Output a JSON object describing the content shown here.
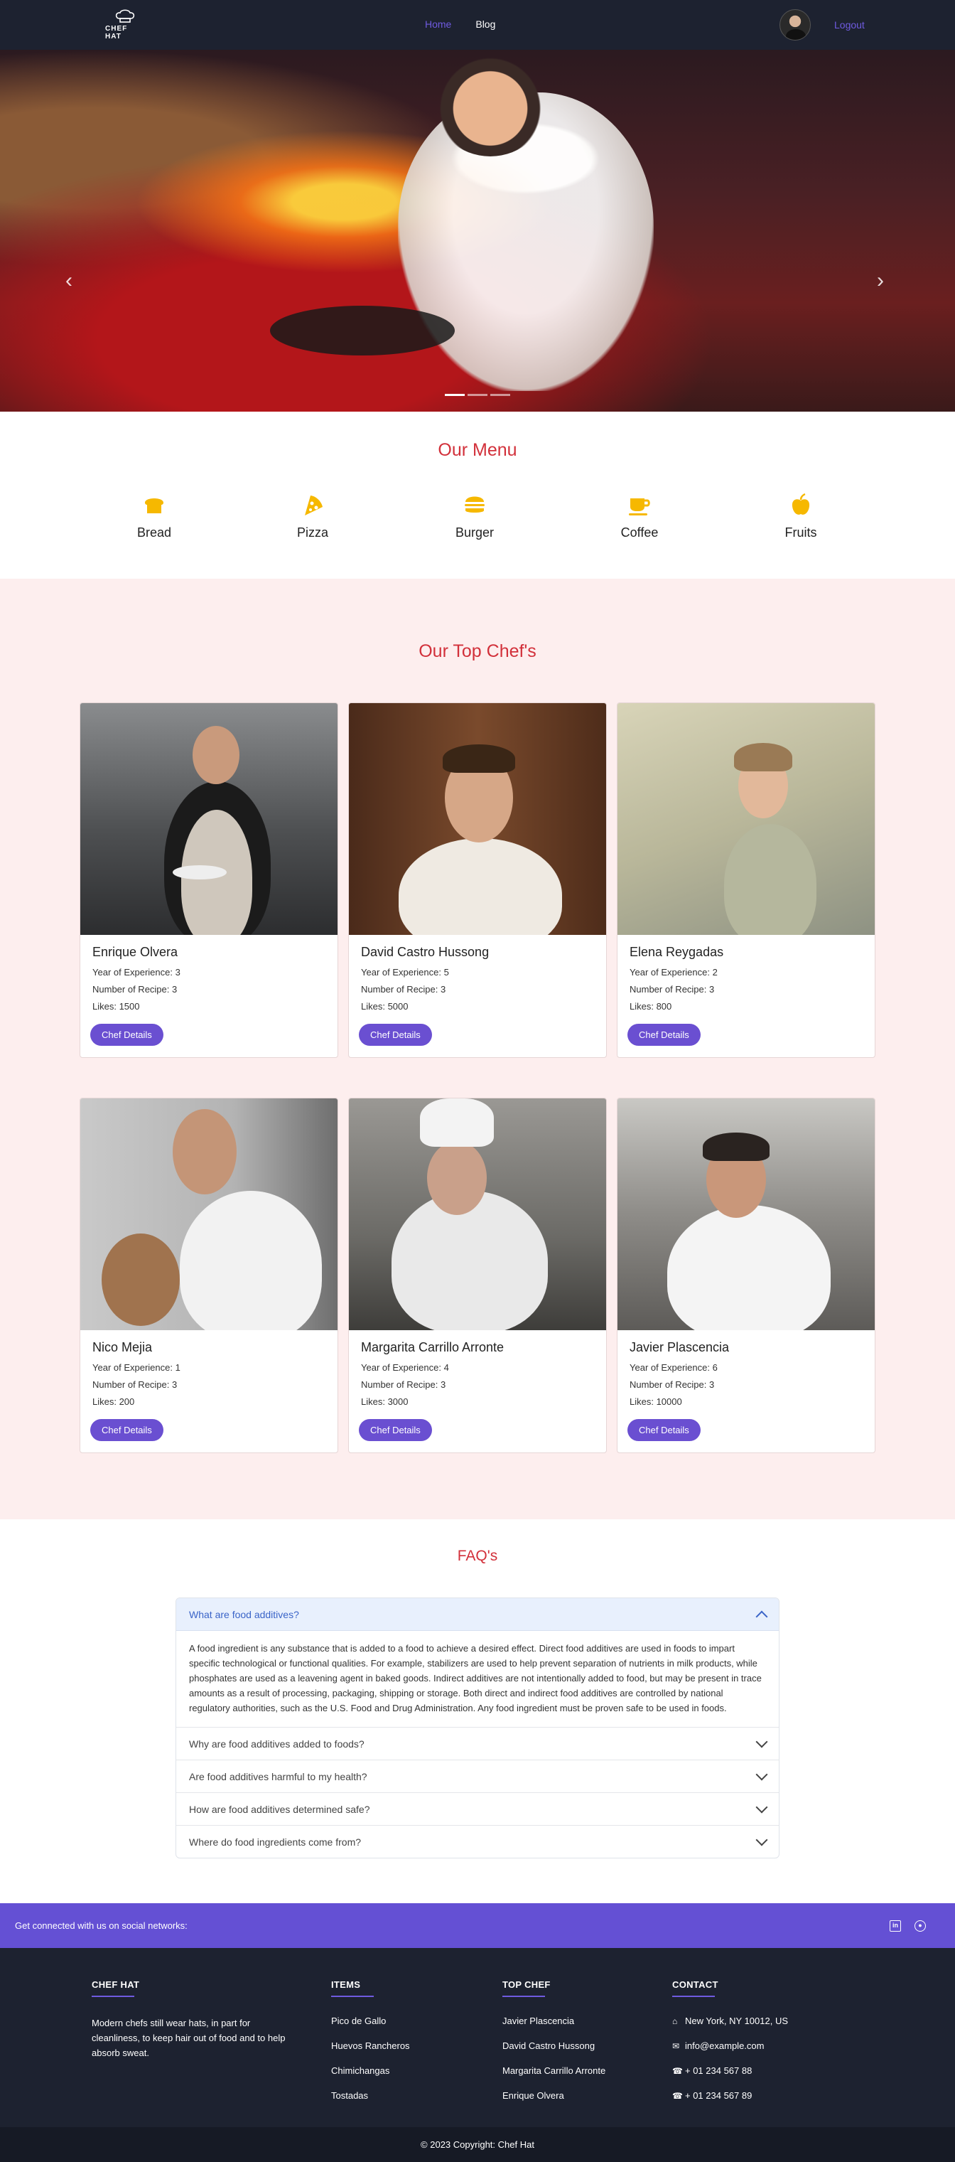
{
  "navbar": {
    "brand": "CHEF HAT",
    "links": [
      "Home",
      "Blog"
    ],
    "logout": "Logout"
  },
  "hero": {
    "slides": 3,
    "active_slide": 1
  },
  "menu": {
    "title": "Our Menu",
    "items": [
      {
        "label": "Bread",
        "icon": "bread-icon"
      },
      {
        "label": "Pizza",
        "icon": "pizza-icon"
      },
      {
        "label": "Burger",
        "icon": "burger-icon"
      },
      {
        "label": "Coffee",
        "icon": "coffee-icon"
      },
      {
        "label": "Fruits",
        "icon": "apple-icon"
      }
    ],
    "icon_color": "#f6b800"
  },
  "chefs": {
    "title": "Our Top Chef's",
    "button_label": "Chef Details",
    "list": [
      {
        "name": "Enrique Olvera",
        "experience": "Year of Experience: 3",
        "recipes": "Number of Recipe: 3",
        "likes": "Likes: 1500"
      },
      {
        "name": "David Castro Hussong",
        "experience": "Year of Experience: 5",
        "recipes": "Number of Recipe: 3",
        "likes": "Likes: 5000"
      },
      {
        "name": "Elena Reygadas",
        "experience": "Year of Experience: 2",
        "recipes": "Number of Recipe: 3",
        "likes": "Likes: 800"
      },
      {
        "name": "Nico Mejia",
        "experience": "Year of Experience: 1",
        "recipes": "Number of Recipe: 3",
        "likes": "Likes: 200"
      },
      {
        "name": "Margarita Carrillo Arronte",
        "experience": "Year of Experience: 4",
        "recipes": "Number of Recipe: 3",
        "likes": "Likes: 3000"
      },
      {
        "name": "Javier Plascencia",
        "experience": "Year of Experience: 6",
        "recipes": "Number of Recipe: 3",
        "likes": "Likes: 10000"
      }
    ]
  },
  "faq": {
    "title": "FAQ's",
    "items": [
      {
        "question": "What are food additives?",
        "open": true,
        "answer": "A food ingredient is any substance that is added to a food to achieve a desired effect. Direct food additives are used in foods to impart specific technological or functional qualities. For example, stabilizers are used to help prevent separation of nutrients in milk products, while phosphates are used as a leavening agent in baked goods. Indirect additives are not intentionally added to food, but may be present in trace amounts as a result of processing, packaging, shipping or storage. Both direct and indirect food additives are controlled by national regulatory authorities, such as the U.S. Food and Drug Administration. Any food ingredient must be proven safe to be used in foods."
      },
      {
        "question": "Why are food additives added to foods?",
        "open": false
      },
      {
        "question": "Are food additives harmful to my health?",
        "open": false
      },
      {
        "question": "How are food additives determined safe?",
        "open": false
      },
      {
        "question": "Where do food ingredients come from?",
        "open": false
      }
    ]
  },
  "social": {
    "text": "Get connected with us on social networks:",
    "icons": [
      "linkedin-icon",
      "github-icon"
    ]
  },
  "footer": {
    "about": {
      "heading": "CHEF HAT",
      "text": "Modern chefs still wear hats, in part for cleanliness, to keep hair out of food and to help absorb sweat."
    },
    "items": {
      "heading": "ITEMS",
      "list": [
        "Pico de Gallo",
        "Huevos Rancheros",
        "Chimichangas",
        "Tostadas"
      ]
    },
    "top_chef": {
      "heading": "TOP CHEF",
      "list": [
        "Javier Plascencia",
        "David Castro Hussong",
        "Margarita Carrillo Arronte",
        "Enrique Olvera"
      ]
    },
    "contact": {
      "heading": "CONTACT",
      "address": "New York, NY 10012, US",
      "email": "info@example.com",
      "phone1": "+ 01 234 567 88",
      "phone2": "+ 01 234 567 89"
    }
  },
  "copyright": "© 2023 Copyright:  Chef Hat",
  "colors": {
    "accent": "#6a4fd1",
    "title_red": "#d2303a",
    "dark_bg": "#1d2230",
    "chef_section_bg": "#fdeeee"
  }
}
